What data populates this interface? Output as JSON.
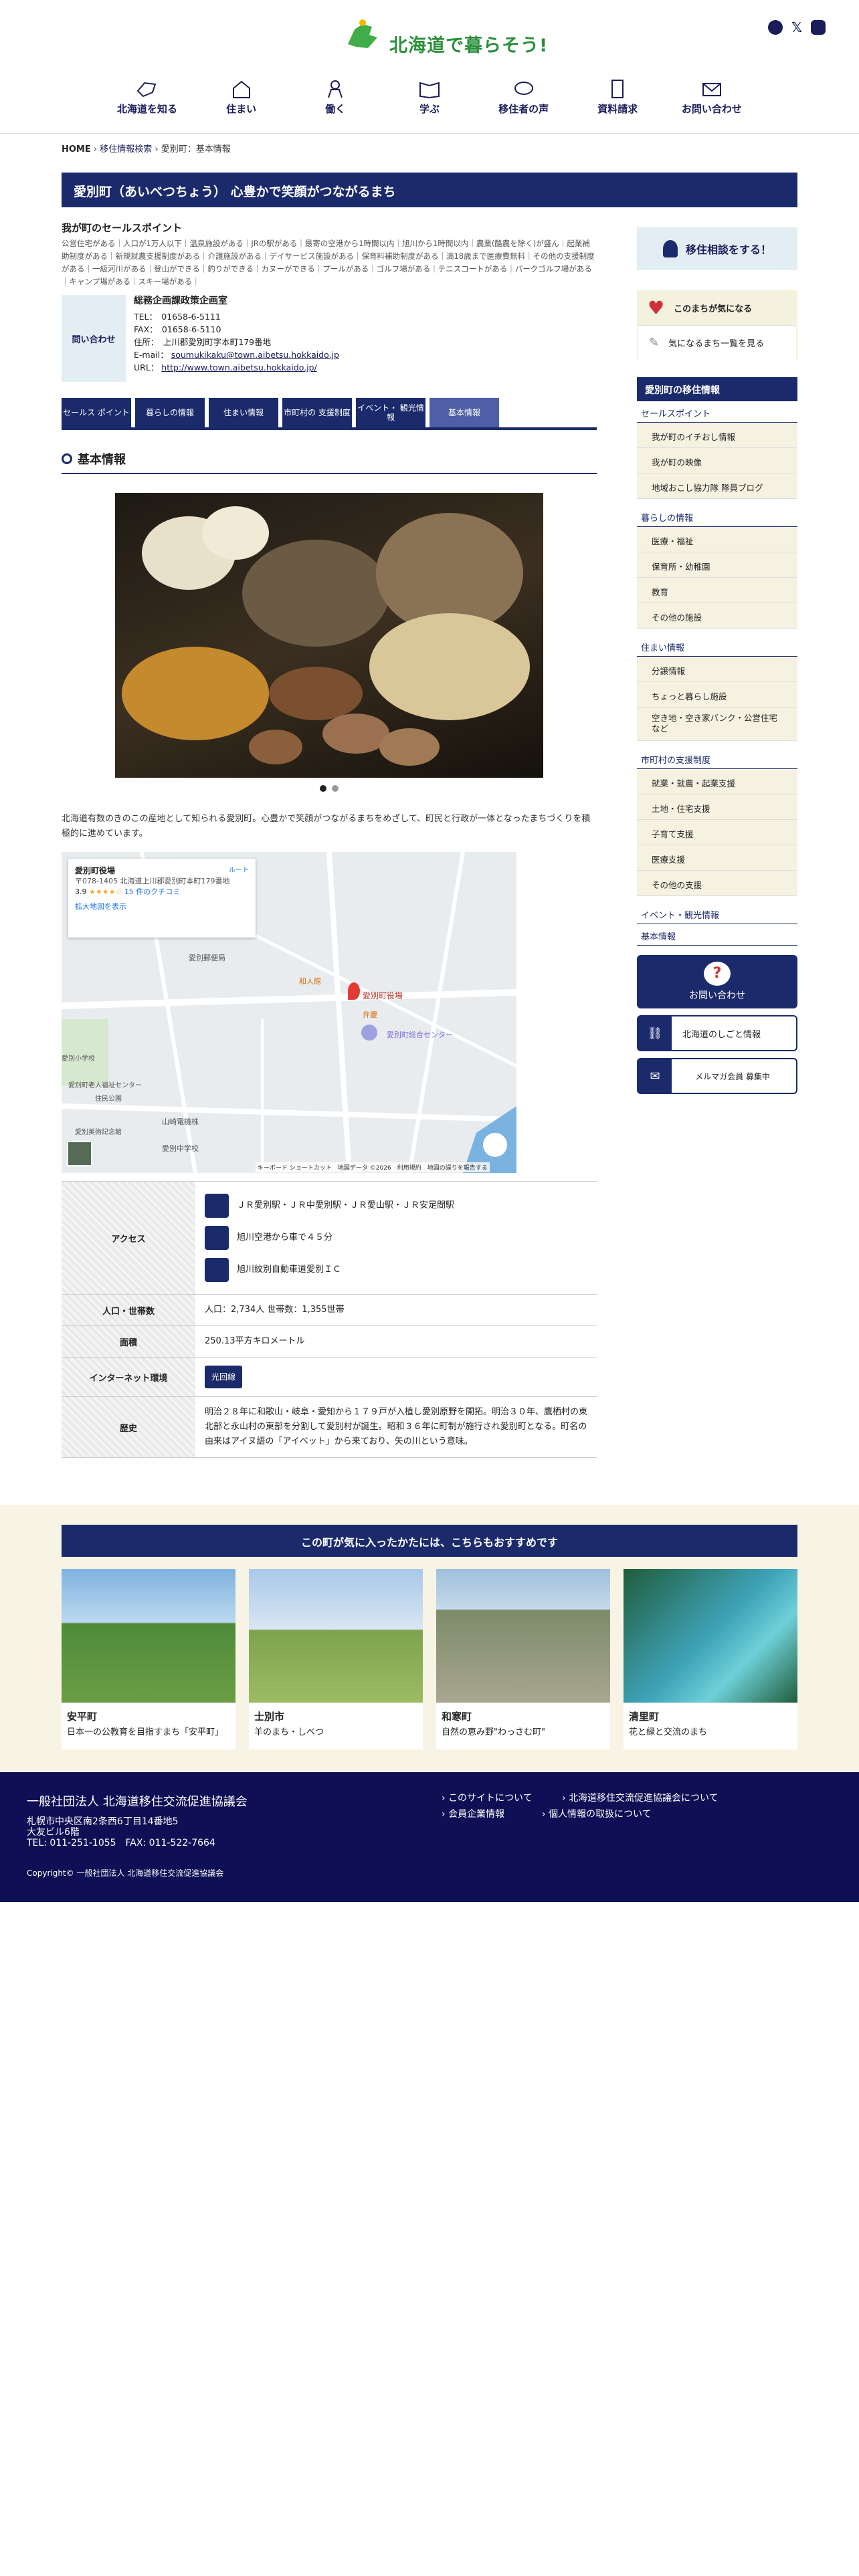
{
  "header": {
    "logo_text": "北海道で暮らそう!",
    "nav": [
      {
        "label": "北海道を知る",
        "icon": "hokkaido-icon"
      },
      {
        "label": "住まい",
        "icon": "house-icon"
      },
      {
        "label": "働く",
        "icon": "worker-icon"
      },
      {
        "label": "学ぶ",
        "icon": "book-icon"
      },
      {
        "label": "移住者の声",
        "icon": "speech-icon"
      },
      {
        "label": "資料請求",
        "icon": "document-icon"
      },
      {
        "label": "お問い合わせ",
        "icon": "mail-icon"
      }
    ]
  },
  "breadcrumb": {
    "home": "HOME",
    "search": "移住情報検索",
    "current": "愛別町：基本情報"
  },
  "title": "愛別町（あいべつちょう） 心豊かで笑顔がつながるまち",
  "sales": {
    "heading": "我が町のセールスポイント",
    "text": "公営住宅がある｜人口が1万人以下｜温泉施設がある｜JRの駅がある｜最寄の空港から1時間以内｜旭川から1時間以内｜農業(酪農を除く)が盛ん｜起業補助制度がある｜新規就農支援制度がある｜介護施設がある｜デイサービス施設がある｜保育料補助制度がある｜満18歳まで医療費無料｜その他の支援制度がある｜一級河川がある｜登山ができる｜釣りができる｜カヌーができる｜プールがある｜ゴルフ場がある｜テニスコートがある｜パークゴルフ場がある｜キャンプ場がある｜スキー場がある｜"
  },
  "contact": {
    "label": "問い合わせ",
    "dept": "総務企画課政策企画室",
    "tel": "TEL：　01658-6-5111",
    "fax": "FAX：　01658-6-5110",
    "addr": "住所：　上川郡愛別町字本町179番地",
    "email_label": "E-mail：",
    "email": "soumukikaku@town.aibetsu.hokkaido.jp",
    "url_label": "URL：",
    "url": "http://www.town.aibetsu.hokkaido.jp/"
  },
  "tabs": [
    "セールス ポイント",
    "暮らしの情報",
    "住まい情報",
    "市町村の 支援制度",
    "イベント・ 観光情報",
    "基本情報"
  ],
  "section_title": "基本情報",
  "intro": "北海道有数のきのこの産地として知られる愛別町。心豊かで笑顔がつながるまちをめざして、町民と行政が一体となったまちづくりを積極的に進めています。",
  "map": {
    "place": "愛別町役場",
    "address": "〒078-1405 北海道上川郡愛別町本町179番地",
    "rating": "3.9",
    "stars": "★★★★☆",
    "reviews": "15 件のクチコミ",
    "route": "ルート",
    "expand": "拡大地図を表示",
    "pin_label": "愛別町役場",
    "labels": [
      "愛別郵便局",
      "和人館",
      "弁慶",
      "愛別町総合センター",
      "山崎電機株",
      "愛別中学校",
      "愛別小学校",
      "愛別町老人福祉センター",
      "住民公園",
      "愛別美術記念館",
      "キーボード ショートカット",
      "地図データ ©2026",
      "利用規約",
      "地図の誤りを報告する"
    ]
  },
  "info": {
    "access_label": "アクセス",
    "access": [
      "ＪＲ愛別駅・ＪＲ中愛別駅・ＪＲ愛山駅・ＪＲ安足間駅",
      "旭川空港から車で４５分",
      "旭川紋別自動車道愛別ＩＣ"
    ],
    "pop_label": "人口・世帯数",
    "pop": "人口：2,734人 世帯数：1,355世帯",
    "area_label": "面積",
    "area": "250.13平方キロメートル",
    "net_label": "インターネット環境",
    "net": "光回線",
    "history_label": "歴史",
    "history": "明治２８年に和歌山・岐阜・愛知から１７９戸が入植し愛別原野を開拓。明治３０年、鷹栖村の東北部と永山村の東部を分割して愛別村が誕生。昭和３６年に町制が施行され愛別町となる。町名の由来はアイヌ語の「アイベット」から来ており、矢の川という意味。"
  },
  "side": {
    "consult": "移住相談をする！",
    "fav1": "このまちが気になる",
    "fav2": "気になるまち一覧を見る",
    "heading": "愛別町の移住情報",
    "menu": [
      {
        "cat": "セールスポイント",
        "items": [
          "我が町のイチおし情報",
          "我が町の映像",
          "地域おこし協力隊 隊員ブログ"
        ]
      },
      {
        "cat": "暮らしの情報",
        "items": [
          "医療・福祉",
          "保育所・幼稚園",
          "教育",
          "その他の施設"
        ]
      },
      {
        "cat": "住まい情報",
        "items": [
          "分譲情報",
          "ちょっと暮らし施設",
          "空き地・空き家バンク・公営住宅など"
        ]
      },
      {
        "cat": "市町村の支援制度",
        "items": [
          "就業・就農・起業支援",
          "土地・住宅支援",
          "子育て支援",
          "医療支援",
          "その他の支援"
        ]
      },
      {
        "cat": "イベント・観光情報",
        "items": []
      },
      {
        "cat": "基本情報",
        "items": []
      }
    ],
    "inquiry": "お問い合わせ",
    "job": "北海道のしごと情報",
    "mail": "メルマガ会員 募集中"
  },
  "recommend": {
    "heading": "この町が気に入ったかたには、こちらもおすすめです",
    "cards": [
      {
        "name": "安平町",
        "desc": "日本一の公教育を目指すまち「安平町」"
      },
      {
        "name": "士別市",
        "desc": "羊のまち・しべつ"
      },
      {
        "name": "和寒町",
        "desc": "自然の恵み野\"わっさむ町\""
      },
      {
        "name": "清里町",
        "desc": "花と緑と交流のまち"
      }
    ]
  },
  "footer": {
    "org": "一般社団法人 北海道移住交流促進協議会",
    "addr1": "札幌市中央区南2条西6丁目14番地5",
    "addr2": "大友ビル6階",
    "tel": "TEL: 011-251-1055　FAX: 011-522-7664",
    "links": [
      "このサイトについて",
      "北海道移住交流促進協議会について",
      "会員企業情報",
      "個人情報の取扱について"
    ],
    "copy": "Copyright© 一般社団法人 北海道移住交流促進協議会"
  },
  "colors": {
    "navy": "#1b2a6b",
    "dark": "#0f0f55",
    "green": "#2a8f3a",
    "cream": "#f7f4e5",
    "light": "#e3edf4"
  }
}
